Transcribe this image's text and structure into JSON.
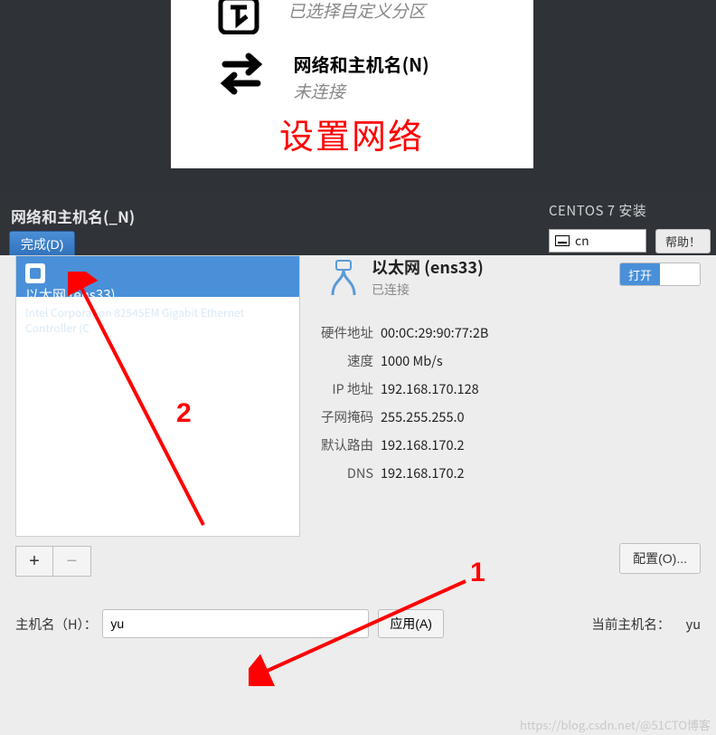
{
  "top": {
    "opt1_title": "已选择自定义分区",
    "opt2_title": "网络和主机名(N)",
    "opt2_sub": "未连接",
    "red_caption": "设置网络"
  },
  "header": {
    "title": "网络和主机名(_N)",
    "done": "完成(D)",
    "installer": "CENTOS 7 安装",
    "lang": "cn",
    "help": "帮助！"
  },
  "device": {
    "name": "以太网 (ens33)",
    "desc": "Intel Corporation 82545EM Gigabit Ethernet Controller (C",
    "plus": "+",
    "minus": "−"
  },
  "eth": {
    "title": "以太网 (ens33)",
    "status": "已连接",
    "toggle_on": "打开"
  },
  "info": {
    "hw_label": "硬件地址",
    "hw": "00:0C:29:90:77:2B",
    "sp_label": "速度",
    "sp": "1000 Mb/s",
    "ip_label": "IP 地址",
    "ip": "192.168.170.128",
    "mask_label": "子网掩码",
    "mask": "255.255.255.0",
    "gw_label": "默认路由",
    "gw": "192.168.170.2",
    "dns_label": "DNS",
    "dns": "192.168.170.2"
  },
  "cfg_btn": "配置(O)...",
  "hostname": {
    "label": "主机名（H）：",
    "value": "yu",
    "apply": "应用(A)",
    "current_label": "当前主机名：",
    "current_value": "yu"
  },
  "ann": {
    "one": "1",
    "two": "2"
  },
  "watermark": "https://blog.csdn.net/@51CTO博客"
}
